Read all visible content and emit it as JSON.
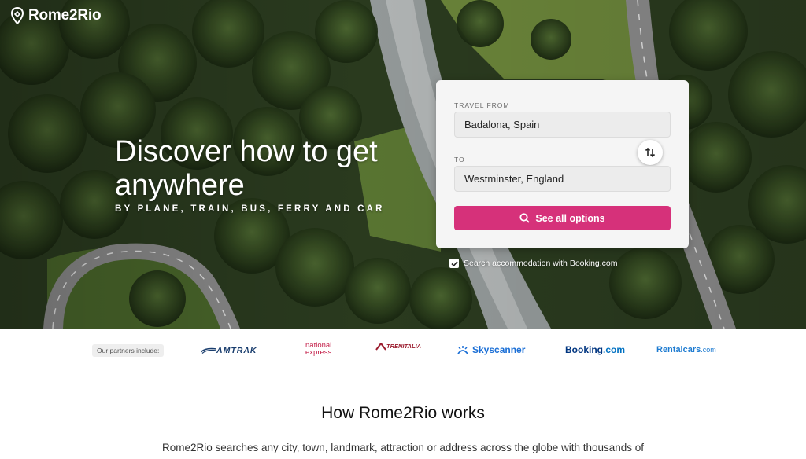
{
  "brand": {
    "name": "Rome2Rio"
  },
  "hero": {
    "headline": "Discover how to get anywhere",
    "subheadline": "BY PLANE, TRAIN, BUS, FERRY AND CAR"
  },
  "search": {
    "from_label": "TRAVEL FROM",
    "from_value": "Badalona, Spain",
    "to_label": "TO",
    "to_value": "Westminster, England",
    "button_label": "See all options",
    "accommodation_label": "Search accommodation with Booking.com",
    "accommodation_checked": true
  },
  "partners": {
    "label": "Our partners include:",
    "logos": {
      "amtrak": "AMTRAK",
      "national_express_1": "national",
      "national_express_2": "express",
      "trenitalia": "TRENITALIA",
      "skyscanner": "Skyscanner",
      "booking_1": "Booking",
      "booking_2": ".com",
      "rentalcars_1": "Rentalcars",
      "rentalcars_2": ".com"
    }
  },
  "how": {
    "title": "How Rome2Rio works",
    "text": "Rome2Rio searches any city, town, landmark, attraction or address across the globe with thousands of"
  },
  "colors": {
    "accent": "#d6317a",
    "forest": "#2d3a22",
    "road": "#8f8f8f"
  }
}
